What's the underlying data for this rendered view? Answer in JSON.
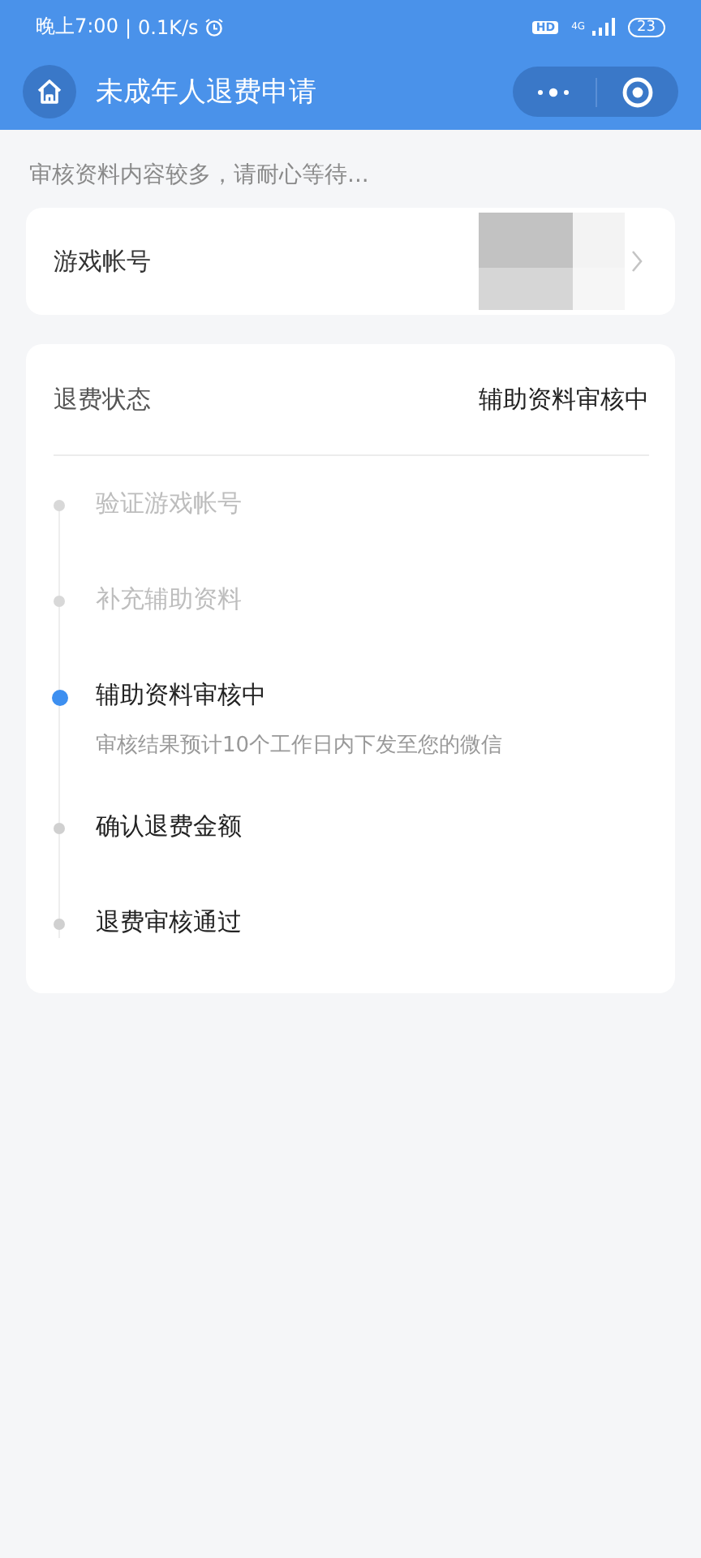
{
  "status_bar": {
    "time": "晚上7:00",
    "separator": "|",
    "speed": "0.1K/s",
    "hd": "HD",
    "network": "4G",
    "battery": "23"
  },
  "nav_bar": {
    "title": "未成年人退费申请"
  },
  "notice": "审核资料内容较多，请耐心等待...",
  "account": {
    "label": "游戏帐号"
  },
  "refund": {
    "label": "退费状态",
    "value": "辅助资料审核中",
    "steps": [
      {
        "title": "验证游戏帐号",
        "kind": "done"
      },
      {
        "title": "补充辅助资料",
        "kind": "done"
      },
      {
        "title": "辅助资料审核中",
        "kind": "current",
        "detail": "审核结果预计10个工作日内下发至您的微信"
      },
      {
        "title": "确认退费金额",
        "kind": "pending"
      },
      {
        "title": "退费审核通过",
        "kind": "pending"
      }
    ]
  }
}
